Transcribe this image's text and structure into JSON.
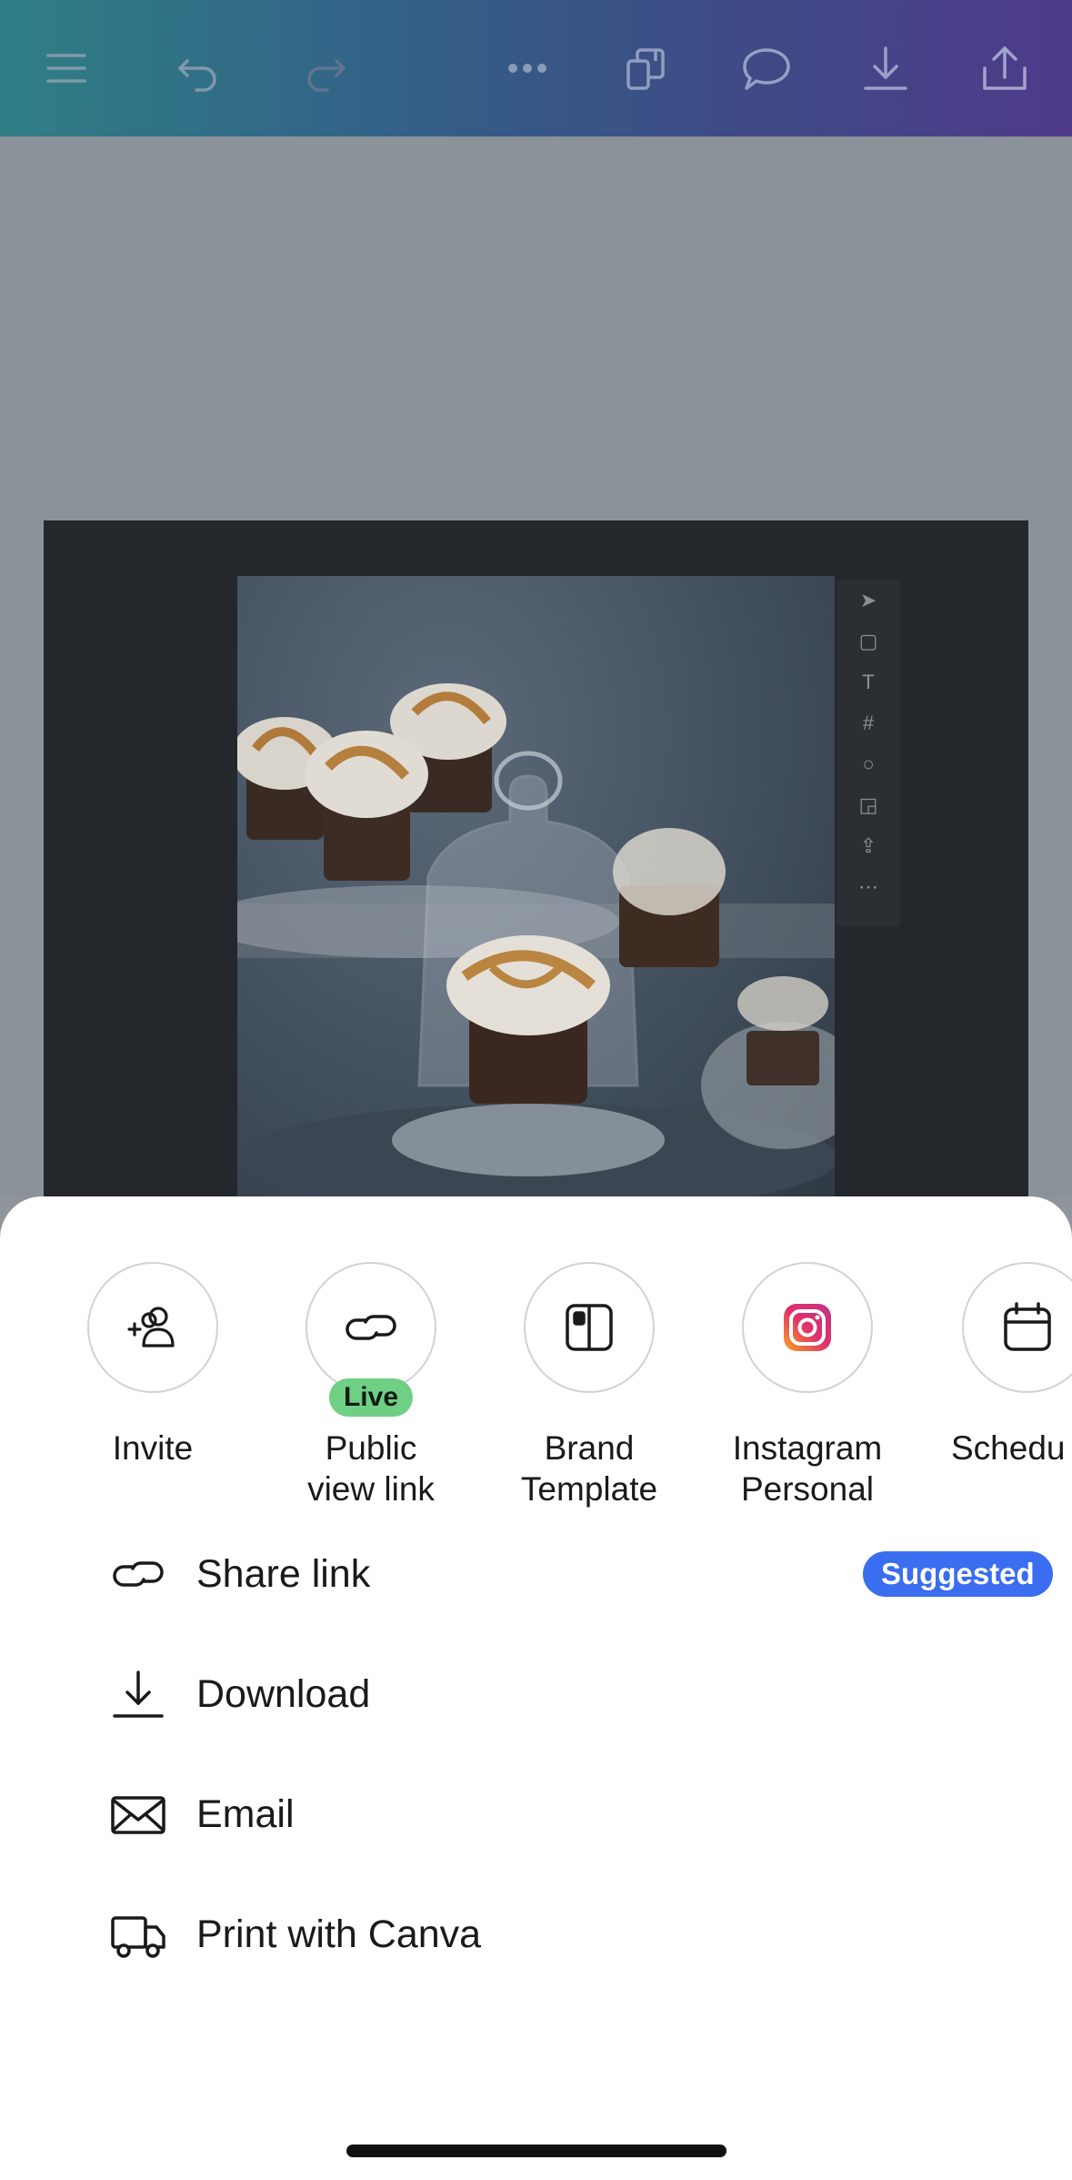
{
  "toolbar": {
    "icons": [
      "menu-icon",
      "undo-icon",
      "redo-icon",
      "more-icon",
      "pages-icon",
      "comment-icon",
      "download-icon",
      "share-icon"
    ]
  },
  "share_options": [
    {
      "label": "Invite",
      "icon": "add-user-icon"
    },
    {
      "label": "Public\nview link",
      "icon": "link-icon",
      "badge": "Live"
    },
    {
      "label": "Brand\nTemplate",
      "icon": "brand-template-icon"
    },
    {
      "label": "Instagram\nPersonal",
      "icon": "instagram-icon"
    },
    {
      "label": "Schedu",
      "icon": "calendar-icon"
    }
  ],
  "share_list": [
    {
      "label": "Share link",
      "icon": "link-icon",
      "badge": "Suggested"
    },
    {
      "label": "Download",
      "icon": "download-icon"
    },
    {
      "label": "Email",
      "icon": "email-icon"
    },
    {
      "label": "Print with Canva",
      "icon": "truck-icon"
    }
  ],
  "colors": {
    "live_badge": "#6fcf84",
    "suggested_badge": "#3a6df0",
    "topbar_start": "#2f7f86",
    "topbar_end": "#4e3a8a"
  }
}
